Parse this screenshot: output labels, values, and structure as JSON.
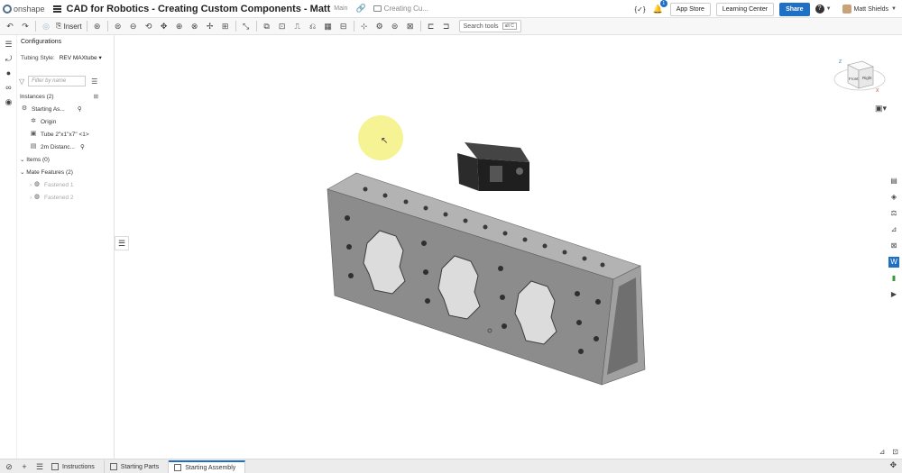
{
  "header": {
    "logo_text": "onshape",
    "doc_title": "CAD for Robotics - Creating Custom Components - Matt",
    "branch": "Main",
    "folder": "Creating Cu...",
    "code_icon": "{✓}",
    "notif_count": "1",
    "app_store": "App Store",
    "learning_center": "Learning Center",
    "share": "Share",
    "help": "?",
    "username": "Matt Shields"
  },
  "toolbar": {
    "insert_label": "Insert",
    "search_tools": "Search tools",
    "search_shortcut": "alt C"
  },
  "panel": {
    "configurations": "Configurations",
    "tubing_label": "Tubing Style:",
    "tubing_value": "REV MAXtube",
    "filter_placeholder": "Filter by name",
    "instances": "Instances (2)",
    "items": [
      {
        "label": "Starting As...",
        "icon": "assembly-icon"
      },
      {
        "label": "Origin",
        "icon": "origin-icon"
      },
      {
        "label": "Tube 2\"x1\"x7\" <1>",
        "icon": "part-icon"
      },
      {
        "label": "2m Distanc...",
        "icon": "sensor-icon"
      }
    ],
    "items_section": "Items (0)",
    "mate_features": "Mate Features (2)",
    "mates": [
      "Fastened 1",
      "Fastened 2"
    ]
  },
  "tabs": [
    {
      "label": "Instructions",
      "icon": "doc-icon"
    },
    {
      "label": "Starting Parts",
      "icon": "partstudio-icon"
    },
    {
      "label": "Starting Assembly",
      "icon": "assembly-icon"
    }
  ],
  "viewcube": {
    "front": "Front",
    "right": "Right",
    "axis_z": "Z",
    "axis_x": "X"
  },
  "colors": {
    "accent": "#1f6fc5",
    "highlight": "#f5f28a",
    "tube": "#8a8a8a"
  }
}
